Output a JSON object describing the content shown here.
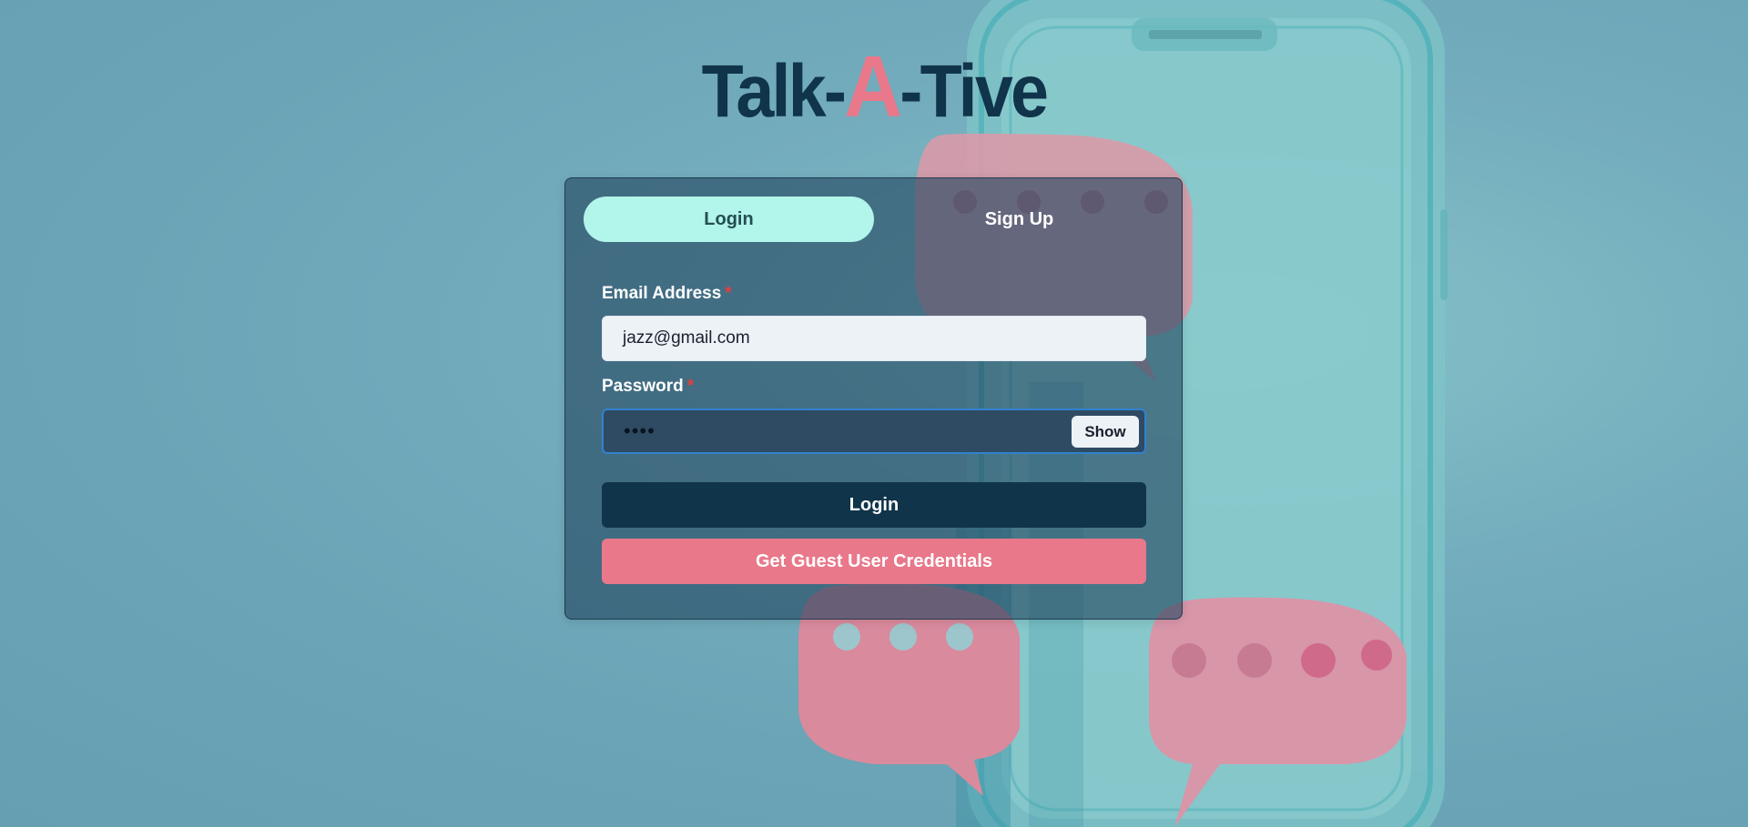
{
  "app": {
    "logo_prefix": "Talk-",
    "logo_accent": "A",
    "logo_suffix": "-Tive"
  },
  "tabs": [
    {
      "label": "Login",
      "active": true
    },
    {
      "label": "Sign Up",
      "active": false
    }
  ],
  "form": {
    "email_label": "Email Address",
    "email_required_mark": "*",
    "email_value": "jazz@gmail.com",
    "password_label": "Password",
    "password_required_mark": "*",
    "password_masked": "••••",
    "show_label": "Show",
    "login_button": "Login",
    "guest_button": "Get Guest User Credentials"
  },
  "colors": {
    "brand_dark": "#10344a",
    "brand_accent": "#e8788a",
    "tab_active_bg": "#b2f5ea",
    "focus_border": "#3182ce"
  },
  "icons": [
    "phone-illustration",
    "speech-bubble-illustration"
  ]
}
